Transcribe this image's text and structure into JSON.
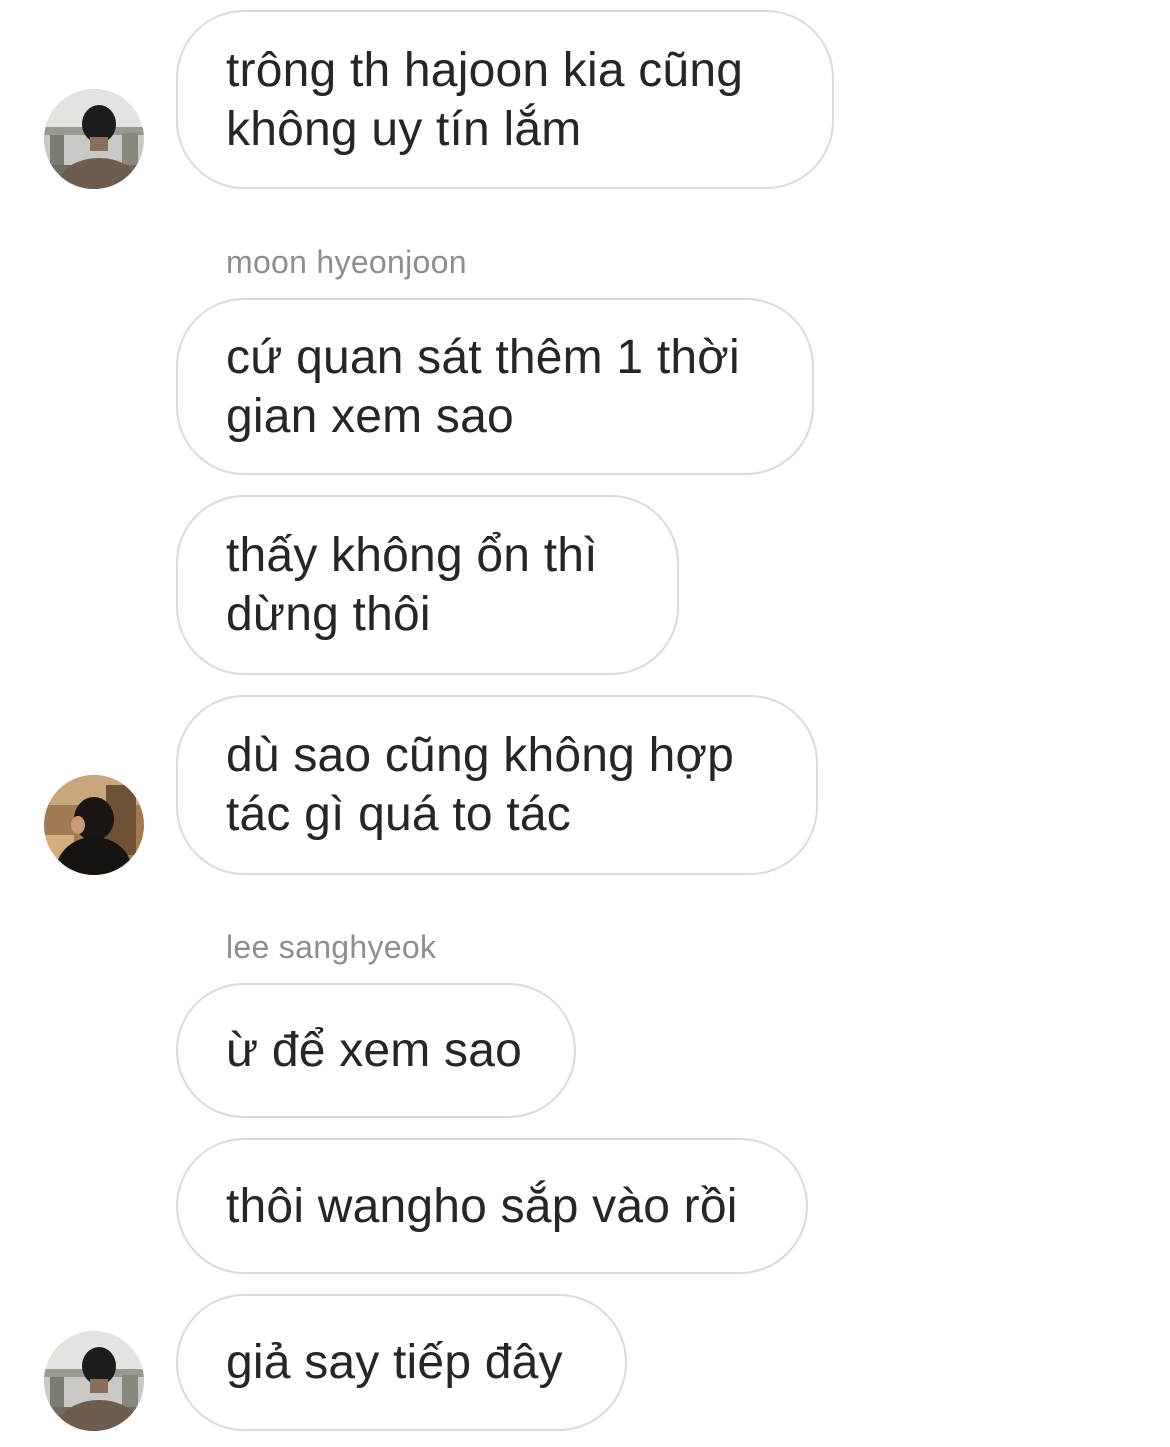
{
  "messages": [
    {
      "text": "trông th hajoon kia cũng\nkhông uy tín lắm",
      "avatar": "avatar-airport-back"
    },
    {
      "sender": "moon hyeonjoon"
    },
    {
      "text": "cứ quan sát thêm 1 thời\ngian xem sao"
    },
    {
      "text": "thấy không ổn thì\ndừng thôi"
    },
    {
      "text": "dù sao cũng không hợp\ntác gì quá to tác",
      "avatar": "avatar-dark-portrait"
    },
    {
      "sender": "lee sanghyeok"
    },
    {
      "text": "ừ để xem sao"
    },
    {
      "text": "thôi wangho sắp vào rồi"
    },
    {
      "text": "giả say tiếp đây",
      "avatar": "avatar-airport-back"
    }
  ],
  "colors": {
    "bubble_border": "#dbdbdb",
    "text": "#262626",
    "sender_name": "#8e8e8e",
    "background": "#ffffff"
  }
}
